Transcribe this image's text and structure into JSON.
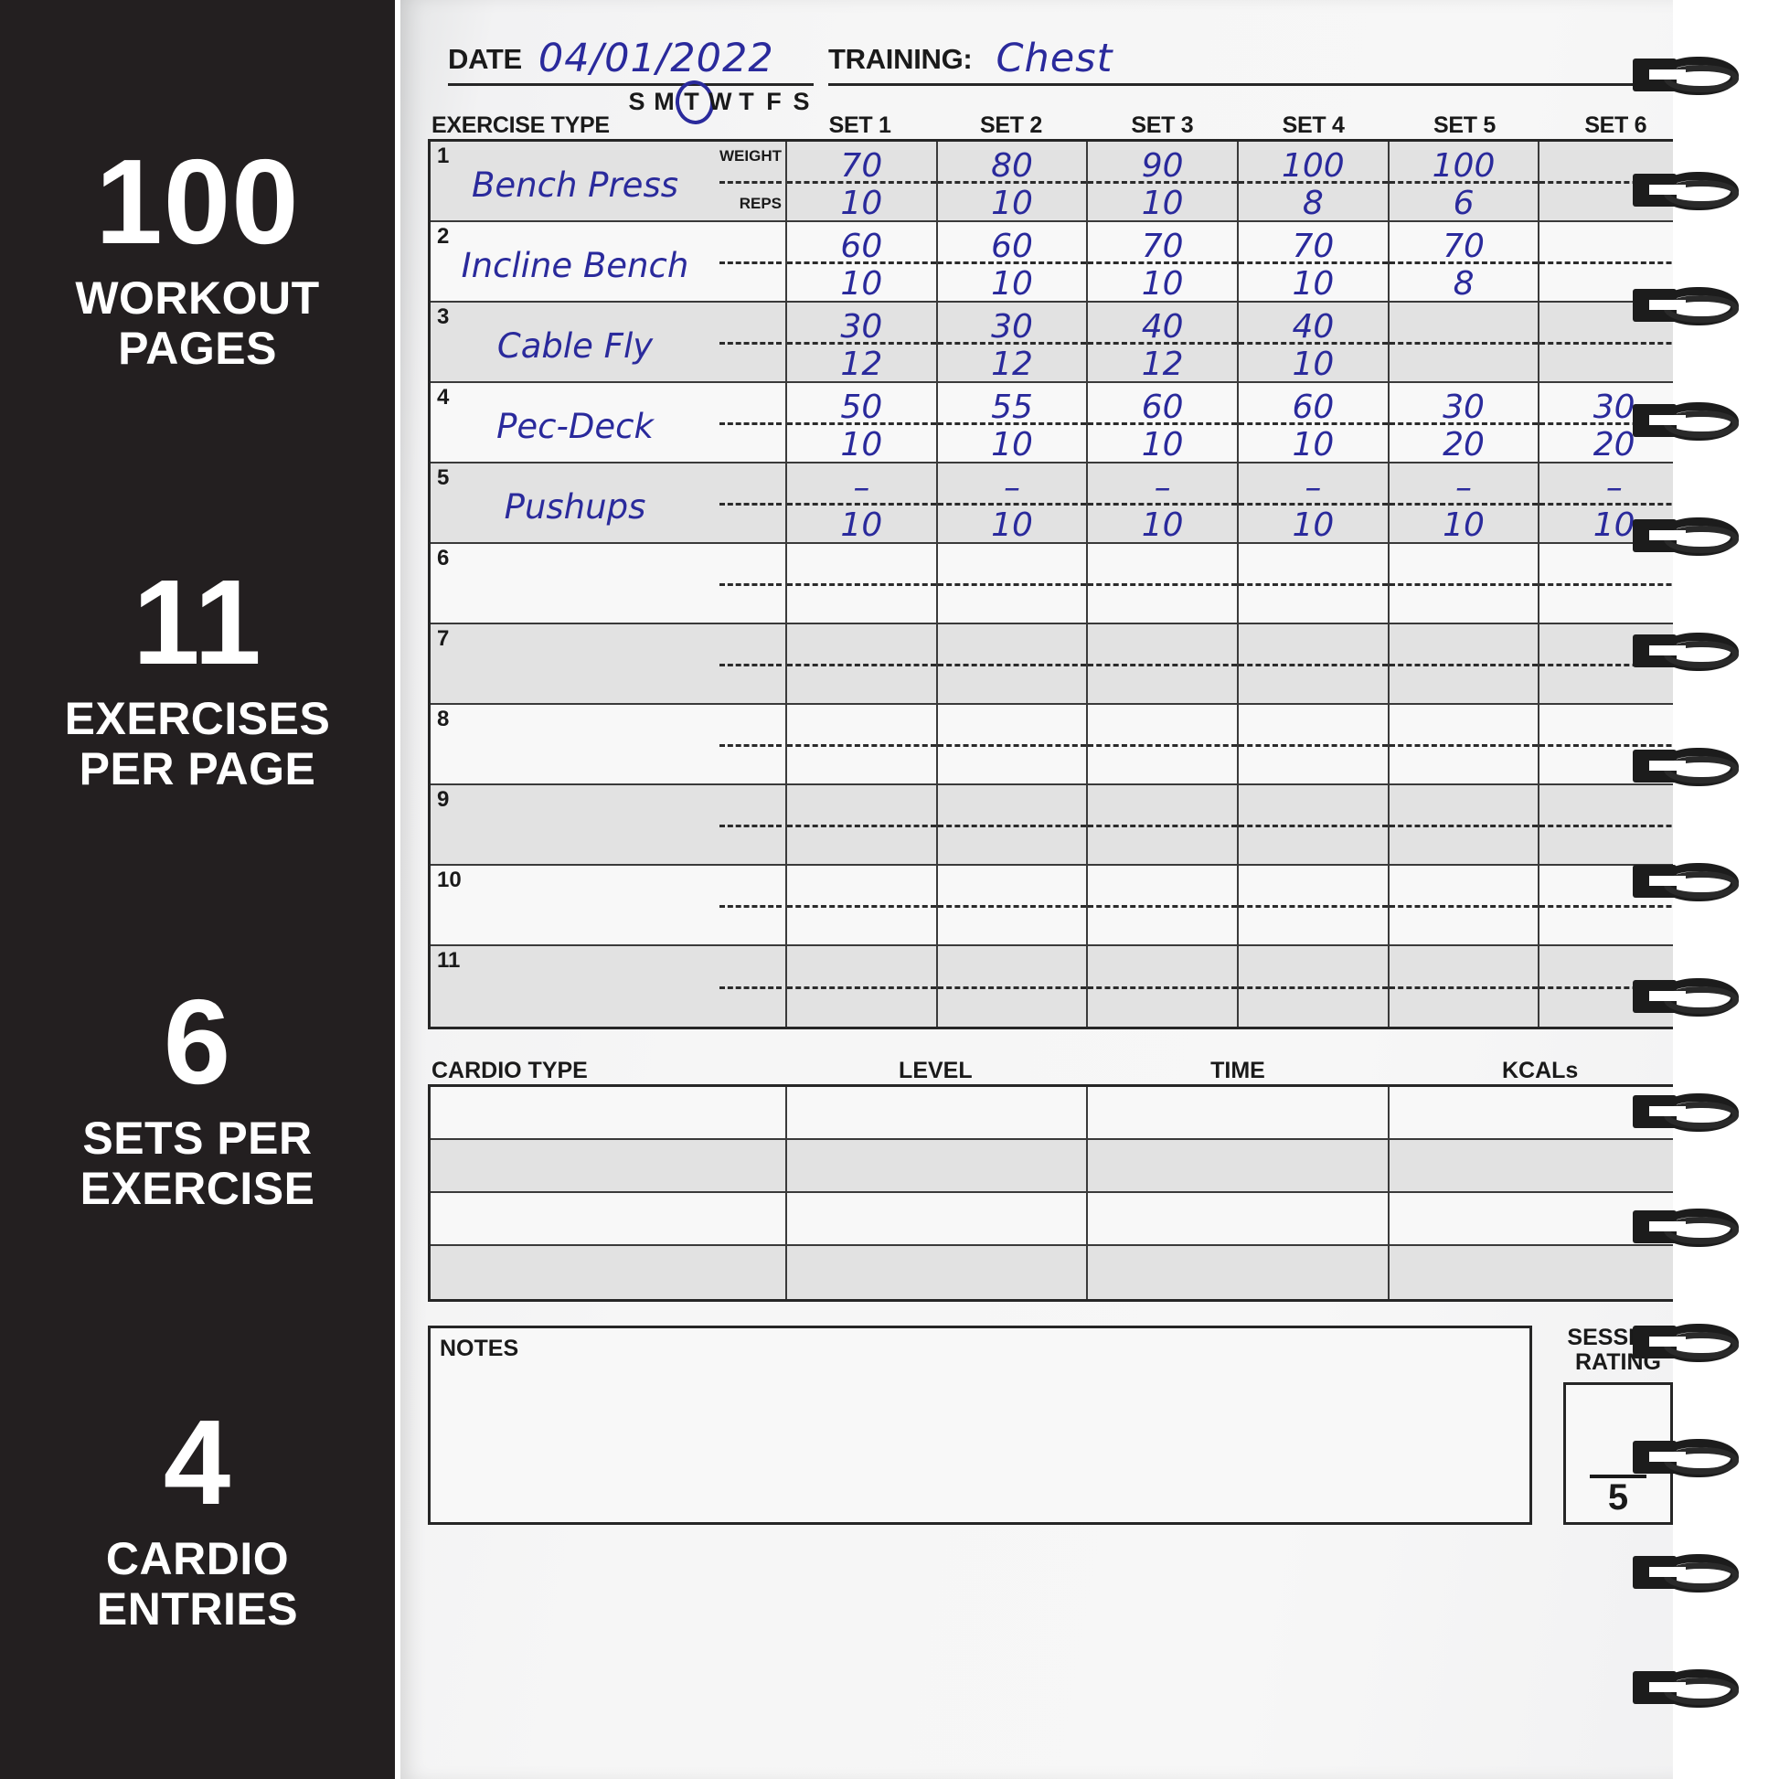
{
  "left_panel": {
    "features": [
      {
        "number": "100",
        "label": "WORKOUT\nPAGES"
      },
      {
        "number": "11",
        "label": "EXERCISES\nPER PAGE"
      },
      {
        "number": "6",
        "label": "SETS PER\nEXERCISE"
      },
      {
        "number": "4",
        "label": "CARDIO\nENTRIES"
      }
    ]
  },
  "page": {
    "header": {
      "date_label": "DATE",
      "date_value": "04/01/2022",
      "training_label": "TRAINING:",
      "training_value": "Chest",
      "weekdays": [
        "S",
        "M",
        "T",
        "W",
        "T",
        "F",
        "S"
      ],
      "weekday_circled_index": 2
    },
    "exercise_table": {
      "name_header": "EXERCISE TYPE",
      "set_headers": [
        "SET 1",
        "SET 2",
        "SET 3",
        "SET 4",
        "SET 5",
        "SET 6"
      ],
      "weight_label": "WEIGHT",
      "reps_label": "REPS",
      "rows": [
        {
          "num": "1",
          "name": "Bench Press",
          "weight": [
            "70",
            "80",
            "90",
            "100",
            "100",
            ""
          ],
          "reps": [
            "10",
            "10",
            "10",
            "8",
            "6",
            ""
          ]
        },
        {
          "num": "2",
          "name": "Incline Bench",
          "weight": [
            "60",
            "60",
            "70",
            "70",
            "70",
            ""
          ],
          "reps": [
            "10",
            "10",
            "10",
            "10",
            "8",
            ""
          ]
        },
        {
          "num": "3",
          "name": "Cable Fly",
          "weight": [
            "30",
            "30",
            "40",
            "40",
            "",
            ""
          ],
          "reps": [
            "12",
            "12",
            "12",
            "10",
            "",
            ""
          ]
        },
        {
          "num": "4",
          "name": "Pec-Deck",
          "weight": [
            "50",
            "55",
            "60",
            "60",
            "30",
            "30"
          ],
          "reps": [
            "10",
            "10",
            "10",
            "10",
            "20",
            "20"
          ]
        },
        {
          "num": "5",
          "name": "Pushups",
          "weight": [
            "–",
            "–",
            "–",
            "–",
            "–",
            "–"
          ],
          "reps": [
            "10",
            "10",
            "10",
            "10",
            "10",
            "10"
          ]
        },
        {
          "num": "6",
          "name": "",
          "weight": [
            "",
            "",
            "",
            "",
            "",
            ""
          ],
          "reps": [
            "",
            "",
            "",
            "",
            "",
            ""
          ]
        },
        {
          "num": "7",
          "name": "",
          "weight": [
            "",
            "",
            "",
            "",
            "",
            ""
          ],
          "reps": [
            "",
            "",
            "",
            "",
            "",
            ""
          ]
        },
        {
          "num": "8",
          "name": "",
          "weight": [
            "",
            "",
            "",
            "",
            "",
            ""
          ],
          "reps": [
            "",
            "",
            "",
            "",
            "",
            ""
          ]
        },
        {
          "num": "9",
          "name": "",
          "weight": [
            "",
            "",
            "",
            "",
            "",
            ""
          ],
          "reps": [
            "",
            "",
            "",
            "",
            "",
            ""
          ]
        },
        {
          "num": "10",
          "name": "",
          "weight": [
            "",
            "",
            "",
            "",
            "",
            ""
          ],
          "reps": [
            "",
            "",
            "",
            "",
            "",
            ""
          ]
        },
        {
          "num": "11",
          "name": "",
          "weight": [
            "",
            "",
            "",
            "",
            "",
            ""
          ],
          "reps": [
            "",
            "",
            "",
            "",
            "",
            ""
          ]
        }
      ]
    },
    "cardio_table": {
      "headers": [
        "CARDIO TYPE",
        "LEVEL",
        "TIME",
        "KCALs"
      ],
      "rows": [
        {
          "type": "",
          "level": "",
          "time": "",
          "kcals": ""
        },
        {
          "type": "",
          "level": "",
          "time": "",
          "kcals": ""
        },
        {
          "type": "",
          "level": "",
          "time": "",
          "kcals": ""
        },
        {
          "type": "",
          "level": "",
          "time": "",
          "kcals": ""
        }
      ]
    },
    "notes": {
      "label": "NOTES",
      "value": ""
    },
    "session_rating": {
      "label_line1": "SESSION",
      "label_line2": "RATING",
      "value": "",
      "denominator": "5"
    }
  },
  "colors": {
    "panel_bg": "#231f20",
    "ink_blue": "#2a2a9c",
    "rule_black": "#262626",
    "row_shaded": "#e2e2e2",
    "row_plain": "#f8f8f8"
  }
}
